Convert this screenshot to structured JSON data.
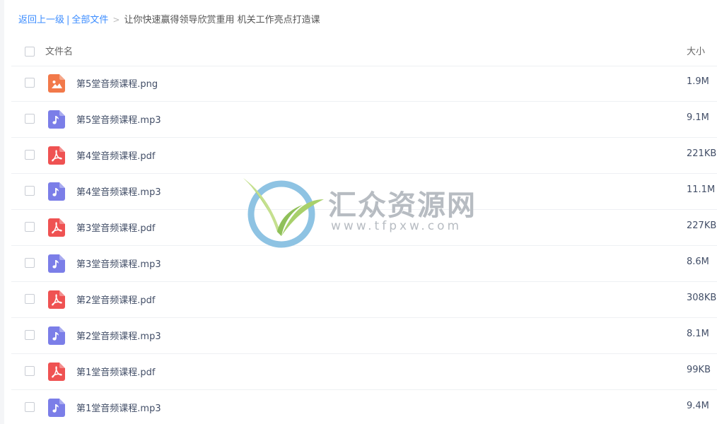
{
  "breadcrumb": {
    "back": "返回上一级",
    "separator": "|",
    "all_files": "全部文件",
    "arrow": ">",
    "current": "让你快速赢得领导欣赏重用 机关工作亮点打造课"
  },
  "header": {
    "name_col": "文件名",
    "size_col": "大小"
  },
  "files": [
    {
      "name": "第5堂音频课程.png",
      "size": "1.9M",
      "type": "image-icon"
    },
    {
      "name": "第5堂音频课程.mp3",
      "size": "9.1M",
      "type": "audio-icon"
    },
    {
      "name": "第4堂音频课程.pdf",
      "size": "221KB",
      "type": "pdf-icon"
    },
    {
      "name": "第4堂音频课程.mp3",
      "size": "11.1M",
      "type": "audio-icon"
    },
    {
      "name": "第3堂音频课程.pdf",
      "size": "227KB",
      "type": "pdf-icon"
    },
    {
      "name": "第3堂音频课程.mp3",
      "size": "8.6M",
      "type": "audio-icon"
    },
    {
      "name": "第2堂音频课程.pdf",
      "size": "308KB",
      "type": "pdf-icon"
    },
    {
      "name": "第2堂音频课程.mp3",
      "size": "8.1M",
      "type": "audio-icon"
    },
    {
      "name": "第1堂音频课程.pdf",
      "size": "99KB",
      "type": "pdf-icon"
    },
    {
      "name": "第1堂音频课程.mp3",
      "size": "9.4M",
      "type": "audio-icon"
    }
  ],
  "watermark": {
    "title": "汇众资源网",
    "url": "www.tfpxw.com"
  },
  "colors": {
    "link": "#3b8cff",
    "image_icon": "#f2794a",
    "audio_icon": "#7b7ee8",
    "pdf_icon": "#ef5252"
  }
}
